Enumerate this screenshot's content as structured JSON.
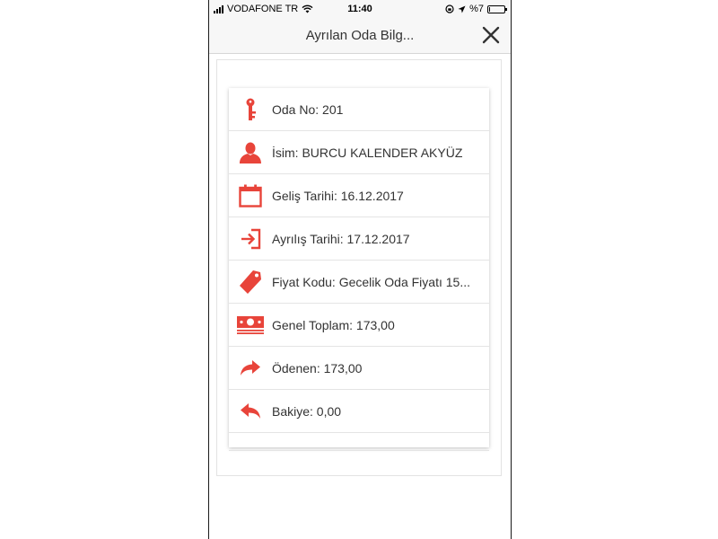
{
  "status_bar": {
    "carrier": "VODAFONE TR",
    "time": "11:40",
    "battery": "%7",
    "battery_level": 0.07
  },
  "header": {
    "title": "Ayrılan Oda Bilg...",
    "close_icon": "close-icon"
  },
  "details": [
    {
      "icon": "key-icon",
      "text": "Oda No: 201"
    },
    {
      "icon": "person-icon",
      "text": "İsim: BURCU KALENDER AKYÜZ"
    },
    {
      "icon": "calendar-icon",
      "text": "Geliş Tarihi: 16.12.2017"
    },
    {
      "icon": "sign-out-icon",
      "text": "Ayrılış Tarihi: 17.12.2017"
    },
    {
      "icon": "price-tag-icon",
      "text": "Fiyat Kodu: Gecelik Oda Fiyatı 15..."
    },
    {
      "icon": "money-icon",
      "text": "Genel Toplam: 173,00"
    },
    {
      "icon": "forward-arrow-icon",
      "text": "Ödenen: 173,00"
    },
    {
      "icon": "reply-arrow-icon",
      "text": "Bakiye: 0,00"
    }
  ],
  "colors": {
    "accent": "#e8443a",
    "text": "#333333",
    "divider": "#e4e4e4"
  }
}
